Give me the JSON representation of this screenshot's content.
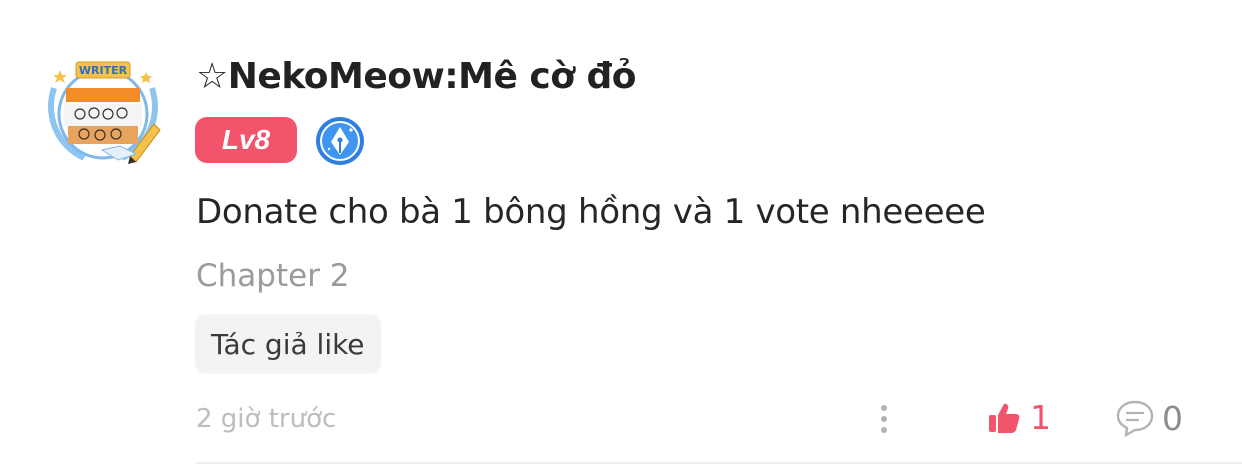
{
  "comment": {
    "username": "☆NekoMeow:Mê cờ đỏ",
    "level": "Lv8",
    "avatar_label": "WRITER",
    "text": "Donate cho bà 1 bông hồng và 1 vote nheeeee",
    "chapter": "Chapter 2",
    "author_like_tag": "Tác giả like",
    "timestamp": "2 giờ trước",
    "like_count": "1",
    "reply_count": "0"
  },
  "colors": {
    "accent": "#f2546c",
    "badge_blue": "#2f7fe0",
    "muted": "#9b9b9b"
  },
  "icons": {
    "more": "more-vertical-icon",
    "like": "thumbs-up-icon",
    "reply": "comment-bubble-icon",
    "writer": "pen-nib-badge-icon"
  }
}
